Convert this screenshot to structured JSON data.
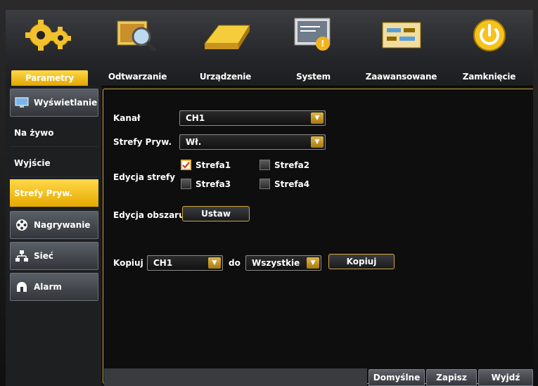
{
  "tabs": [
    {
      "label": "Parametry",
      "icon": "gears-icon",
      "active": true
    },
    {
      "label": "Odtwarzanie",
      "icon": "playback-magnifier-icon",
      "active": false
    },
    {
      "label": "Urządzenie",
      "icon": "hdd-icon",
      "active": false
    },
    {
      "label": "System",
      "icon": "monitor-info-icon",
      "active": false
    },
    {
      "label": "Zaawansowane",
      "icon": "sliders-icon",
      "active": false
    },
    {
      "label": "Zamknięcie",
      "icon": "power-icon",
      "active": false
    }
  ],
  "sidebar": {
    "items": [
      {
        "label": "Wyświetlanie",
        "icon": "monitor-icon",
        "kind": "header"
      },
      {
        "label": "Na żywo",
        "kind": "sub"
      },
      {
        "label": "Wyjście",
        "kind": "sub"
      },
      {
        "label": "Strefy Pryw.",
        "kind": "selected"
      },
      {
        "label": "Nagrywanie",
        "icon": "film-reel-icon",
        "kind": "header"
      },
      {
        "label": "Sieć",
        "icon": "network-icon",
        "kind": "header"
      },
      {
        "label": "Alarm",
        "icon": "alarm-bell-icon",
        "kind": "header"
      }
    ]
  },
  "form": {
    "kanal_label": "Kanał",
    "kanal_value": "CH1",
    "strefy_label": "Strefy Pryw.",
    "strefy_value": "Wł.",
    "edycja_strefy_label": "Edycja strefy",
    "zones": [
      {
        "label": "Strefa1",
        "checked": true
      },
      {
        "label": "Strefa2",
        "checked": false
      },
      {
        "label": "Strefa3",
        "checked": false
      },
      {
        "label": "Strefa4",
        "checked": false
      }
    ],
    "edycja_obszaru_label": "Edycja obszaru",
    "ustaw_label": "Ustaw",
    "kopiuj_label": "Kopiuj",
    "copy_from_value": "CH1",
    "do_label": "do",
    "copy_to_value": "Wszystkie",
    "kopiuj_button": "Kopiuj"
  },
  "footer": {
    "default_label": "Domyślne",
    "save_label": "Zapisz",
    "exit_label": "Wyjdź"
  },
  "colors": {
    "accent": "#e6a900",
    "border_gold": "#c9a23a"
  }
}
